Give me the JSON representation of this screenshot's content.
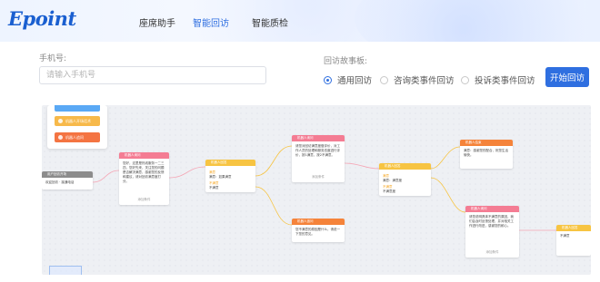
{
  "header": {
    "logo": "Epoint",
    "nav": [
      "座席助手",
      "智能回访",
      "智能质检"
    ],
    "active_nav": "智能回访"
  },
  "form": {
    "phone_label": "手机号:",
    "phone_placeholder": "请输入手机号",
    "phone_value": "",
    "template_label": "回访故事板:",
    "options": [
      {
        "label": "通用回访",
        "checked": true
      },
      {
        "label": "咨询类事件回访",
        "checked": false
      },
      {
        "label": "投诉类事件回访",
        "checked": false
      }
    ],
    "start_button": "开始回访"
  },
  "canvas": {
    "palette": [
      "机器人开场话术",
      "机器人追问"
    ],
    "nodes": {
      "start": {
        "title": "用户回访开场",
        "body": "欢迎回访 · 接通电话"
      },
      "n1": {
        "title": "机器人询问",
        "body": "您好，这里是热线服务一二三四，您好先来，关注您的问题是否解决满意，感谢您的反馈和建议，请对回访满意度打分。"
      },
      "n2": {
        "title": "机器人回答",
        "opt1": "满意",
        "val1": "满意：如果满意",
        "opt2": "不满意",
        "val2": "不满意"
      },
      "n3": {
        "title": "机器人询问",
        "body": "请您对回访满意度做评价，对工作人员的处理和服务态度进行评价，按1满意，按2不满意。"
      },
      "n4": {
        "title": "机器人回答",
        "opt1": "满意",
        "val1": "满意：满意度",
        "opt2": "不满意",
        "val2": "不满意度"
      },
      "n5": {
        "title": "机器人结束",
        "body": "满意：感谢您的配合，祝您生活愉快。"
      },
      "n6": {
        "title": "机器人追问",
        "body": "您不满意的原因是什么，请说一下您的意见。"
      },
      "n7": {
        "title": "机器人询问",
        "body": "请您说明具体不满意的原因，我们会及时反馈处理，并对相关工作进行改进，感谢您的耐心。"
      },
      "n8": {
        "title": "机器人回答",
        "body": "不满意"
      }
    },
    "footer_text": "添加条件"
  }
}
